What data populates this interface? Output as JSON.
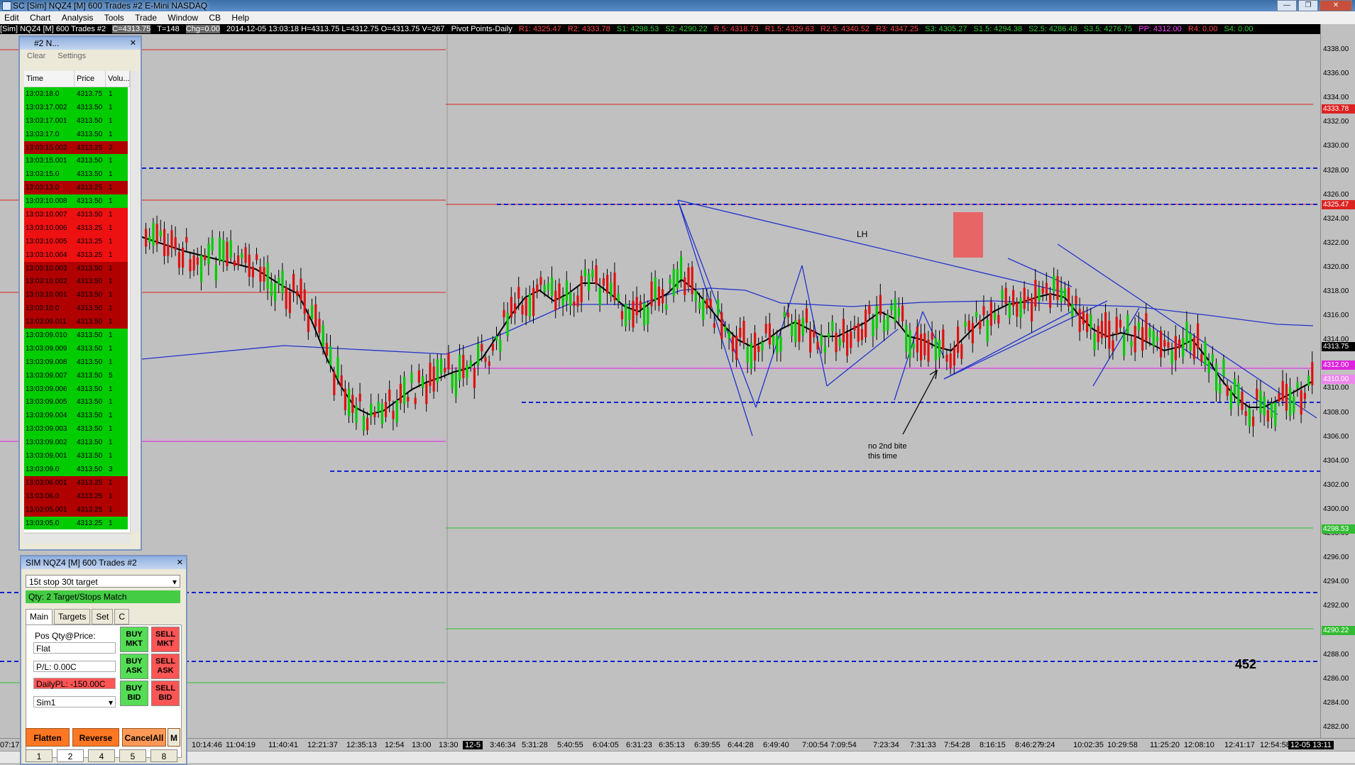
{
  "window": {
    "title": "SC [Sim] NQZ4 [M]  600 Trades  #2  E-Mini NASDAQ"
  },
  "menu": [
    "Edit",
    "Chart",
    "Analysis",
    "Tools",
    "Trade",
    "Window",
    "CB",
    "Help"
  ],
  "infobar": {
    "symbol": "[Sim] NQZ4 [M]  600 Trades  #2",
    "c": "C=4313.75",
    "t": "T=148",
    "chg": "Chg=0.00",
    "ohlc": "2014-12-05 13:03:18 H=4313.75 L=4312.75 O=4313.75 V=267",
    "study": "Pivot Points-Daily",
    "r1": "R1: 4325.47",
    "r2": "R2: 4333.78",
    "s1": "S1: 4298.53",
    "s2": "S2: 4290.22",
    "r05": "R.5: 4318.73",
    "r15": "R1.5: 4329.63",
    "r25": "R2.5: 4340.52",
    "r3": "R3: 4347.25",
    "s3": "S3: 4305.27",
    "s15": "S1.5: 4294.38",
    "s25": "S2.5: 4286.48",
    "s35": "S3.5: 4276.75",
    "pp": "PP: 4312.00",
    "r4": "R4: 0.00",
    "s4": "S4: 0.00"
  },
  "chart": {
    "annotation_lh": "LH",
    "annotation_note_1": "no 2nd bite",
    "annotation_note_2": "this time",
    "annotation_num": "452",
    "colors": {
      "up": "#00cc00",
      "down": "#dd1111",
      "ma": "#000000",
      "vwap": "#2233cc",
      "pivot_dash": "#1122cc",
      "resist": "#dd2222",
      "support": "#33bb33",
      "pp": "#dd22dd"
    }
  },
  "price_labels": [
    "4338.00",
    "4336.00",
    "4334.00",
    "4332.00",
    "4330.00",
    "4328.00",
    "4326.00",
    "4324.00",
    "4322.00",
    "4320.00",
    "4318.00",
    "4316.00",
    "4314.00",
    "4312.00",
    "4310.00",
    "4308.00",
    "4306.00",
    "4304.00",
    "4302.00",
    "4300.00",
    "4298.00",
    "4296.00",
    "4294.00",
    "4292.00",
    "4290.00",
    "4288.00",
    "4286.00",
    "4284.00",
    "4282.00"
  ],
  "price_tags": [
    {
      "label": "4333.78",
      "color": "#dd2222"
    },
    {
      "label": "4325.47",
      "color": "#dd2222"
    },
    {
      "label": "4313.75",
      "color": "#000000"
    },
    {
      "label": "4312.00",
      "color": "#dd22dd"
    },
    {
      "label": "4310.00",
      "color": "#ee88ee"
    },
    {
      "label": "4298.53",
      "color": "#33bb33"
    },
    {
      "label": "4290.22",
      "color": "#33bb33"
    }
  ],
  "time_labels": [
    "07:17",
    "10:14:46",
    "11:04:19",
    "11:40:41",
    "12:21:37",
    "12:35:13",
    "12:54",
    "13:00",
    "13:30",
    "12-5",
    "3:46:34",
    "5:31:28",
    "5:40:55",
    "6:04:05",
    "6:31:23",
    "6:35:13",
    "6:39:55",
    "6:44:28",
    "6:49:40",
    "7:00:54",
    "7:09:54",
    "7:23:34",
    "7:31:33",
    "7:54:28",
    "8:16:15",
    "8:46:27",
    "9:24",
    "10:02:35",
    "10:29:58",
    "11:25:20",
    "12:08:10",
    "12:41:17",
    "12:54:58",
    "12-05 13:11"
  ],
  "time_sales": {
    "title": "#2 N...",
    "toolbar": {
      "clear": "Clear",
      "settings": "Settings"
    },
    "columns": [
      "Time",
      "Price",
      "Volu..."
    ],
    "rows": [
      {
        "time": "13:03:18.0",
        "price": "4313.75",
        "vol": "1",
        "side": "g"
      },
      {
        "time": "13:03:17.002",
        "price": "4313.50",
        "vol": "1",
        "side": "g"
      },
      {
        "time": "13:03:17.001",
        "price": "4313.50",
        "vol": "1",
        "side": "g"
      },
      {
        "time": "13:03:17.0",
        "price": "4313.50",
        "vol": "1",
        "side": "g"
      },
      {
        "time": "13:03:15.002",
        "price": "4313.25",
        "vol": "2",
        "side": "dr"
      },
      {
        "time": "13:03:15.001",
        "price": "4313.50",
        "vol": "1",
        "side": "g"
      },
      {
        "time": "13:03:15.0",
        "price": "4313.50",
        "vol": "1",
        "side": "g"
      },
      {
        "time": "13:03:13.0",
        "price": "4313.25",
        "vol": "1",
        "side": "dr"
      },
      {
        "time": "13:03:10.008",
        "price": "4313.50",
        "vol": "1",
        "side": "g"
      },
      {
        "time": "13:03:10.007",
        "price": "4313.50",
        "vol": "1",
        "side": "r"
      },
      {
        "time": "13:03:10.006",
        "price": "4313.25",
        "vol": "1",
        "side": "r"
      },
      {
        "time": "13:03:10.005",
        "price": "4313.25",
        "vol": "1",
        "side": "r"
      },
      {
        "time": "13:03:10.004",
        "price": "4313.25",
        "vol": "1",
        "side": "r"
      },
      {
        "time": "13:03:10.003",
        "price": "4313.50",
        "vol": "1",
        "side": "dr"
      },
      {
        "time": "13:03:10.002",
        "price": "4313.50",
        "vol": "1",
        "side": "dr"
      },
      {
        "time": "13:03:10.001",
        "price": "4313.50",
        "vol": "1",
        "side": "dr"
      },
      {
        "time": "13:03:10.0",
        "price": "4313.50",
        "vol": "1",
        "side": "dr"
      },
      {
        "time": "13:03:09.011",
        "price": "4313.50",
        "vol": "1",
        "side": "dr"
      },
      {
        "time": "13:03:09.010",
        "price": "4313.50",
        "vol": "1",
        "side": "g"
      },
      {
        "time": "13:03:09.009",
        "price": "4313.50",
        "vol": "1",
        "side": "g"
      },
      {
        "time": "13:03:09.008",
        "price": "4313.50",
        "vol": "1",
        "side": "g"
      },
      {
        "time": "13:03:09.007",
        "price": "4313.50",
        "vol": "5",
        "side": "g"
      },
      {
        "time": "13:03:09.006",
        "price": "4313.50",
        "vol": "1",
        "side": "g"
      },
      {
        "time": "13:03:09.005",
        "price": "4313.50",
        "vol": "1",
        "side": "g"
      },
      {
        "time": "13:03:09.004",
        "price": "4313.50",
        "vol": "1",
        "side": "g"
      },
      {
        "time": "13:03:09.003",
        "price": "4313.50",
        "vol": "1",
        "side": "g"
      },
      {
        "time": "13:03:09.002",
        "price": "4313.50",
        "vol": "1",
        "side": "g"
      },
      {
        "time": "13:03:09.001",
        "price": "4313.50",
        "vol": "1",
        "side": "g"
      },
      {
        "time": "13:03:09.0",
        "price": "4313.50",
        "vol": "3",
        "side": "g"
      },
      {
        "time": "13:03:06.001",
        "price": "4313.25",
        "vol": "1",
        "side": "dr"
      },
      {
        "time": "13:03:06.0",
        "price": "4313.25",
        "vol": "1",
        "side": "dr"
      },
      {
        "time": "13:03:05.001",
        "price": "4313.25",
        "vol": "1",
        "side": "dr"
      },
      {
        "time": "13:03:05.0",
        "price": "4313.25",
        "vol": "1",
        "side": "g"
      }
    ]
  },
  "order_entry": {
    "title": "SIM NQZ4 [M]  600 Trades  #2",
    "strategy": "15t stop 30t target",
    "qty_match": "Qty: 2 Target/Stops Match",
    "tabs": [
      "Main",
      "Targets",
      "Set",
      "C"
    ],
    "pos_label": "Pos Qty@Price:",
    "pos_value": "Flat",
    "pl": "P/L: 0.00C",
    "daily_pl": "DailyPL: -150.00C",
    "account": "Sim1",
    "buy_mkt": "BUY MKT",
    "sell_mkt": "SELL MKT",
    "buy_ask": "BUY ASK",
    "sell_ask": "SELL ASK",
    "buy_bid": "BUY BID",
    "sell_bid": "SELL BID",
    "flatten": "Flatten",
    "reverse": "Reverse",
    "cancel_all": "CancelAll",
    "m": "M",
    "qty_buttons": [
      "1",
      "2",
      "4",
      "5",
      "8"
    ]
  }
}
